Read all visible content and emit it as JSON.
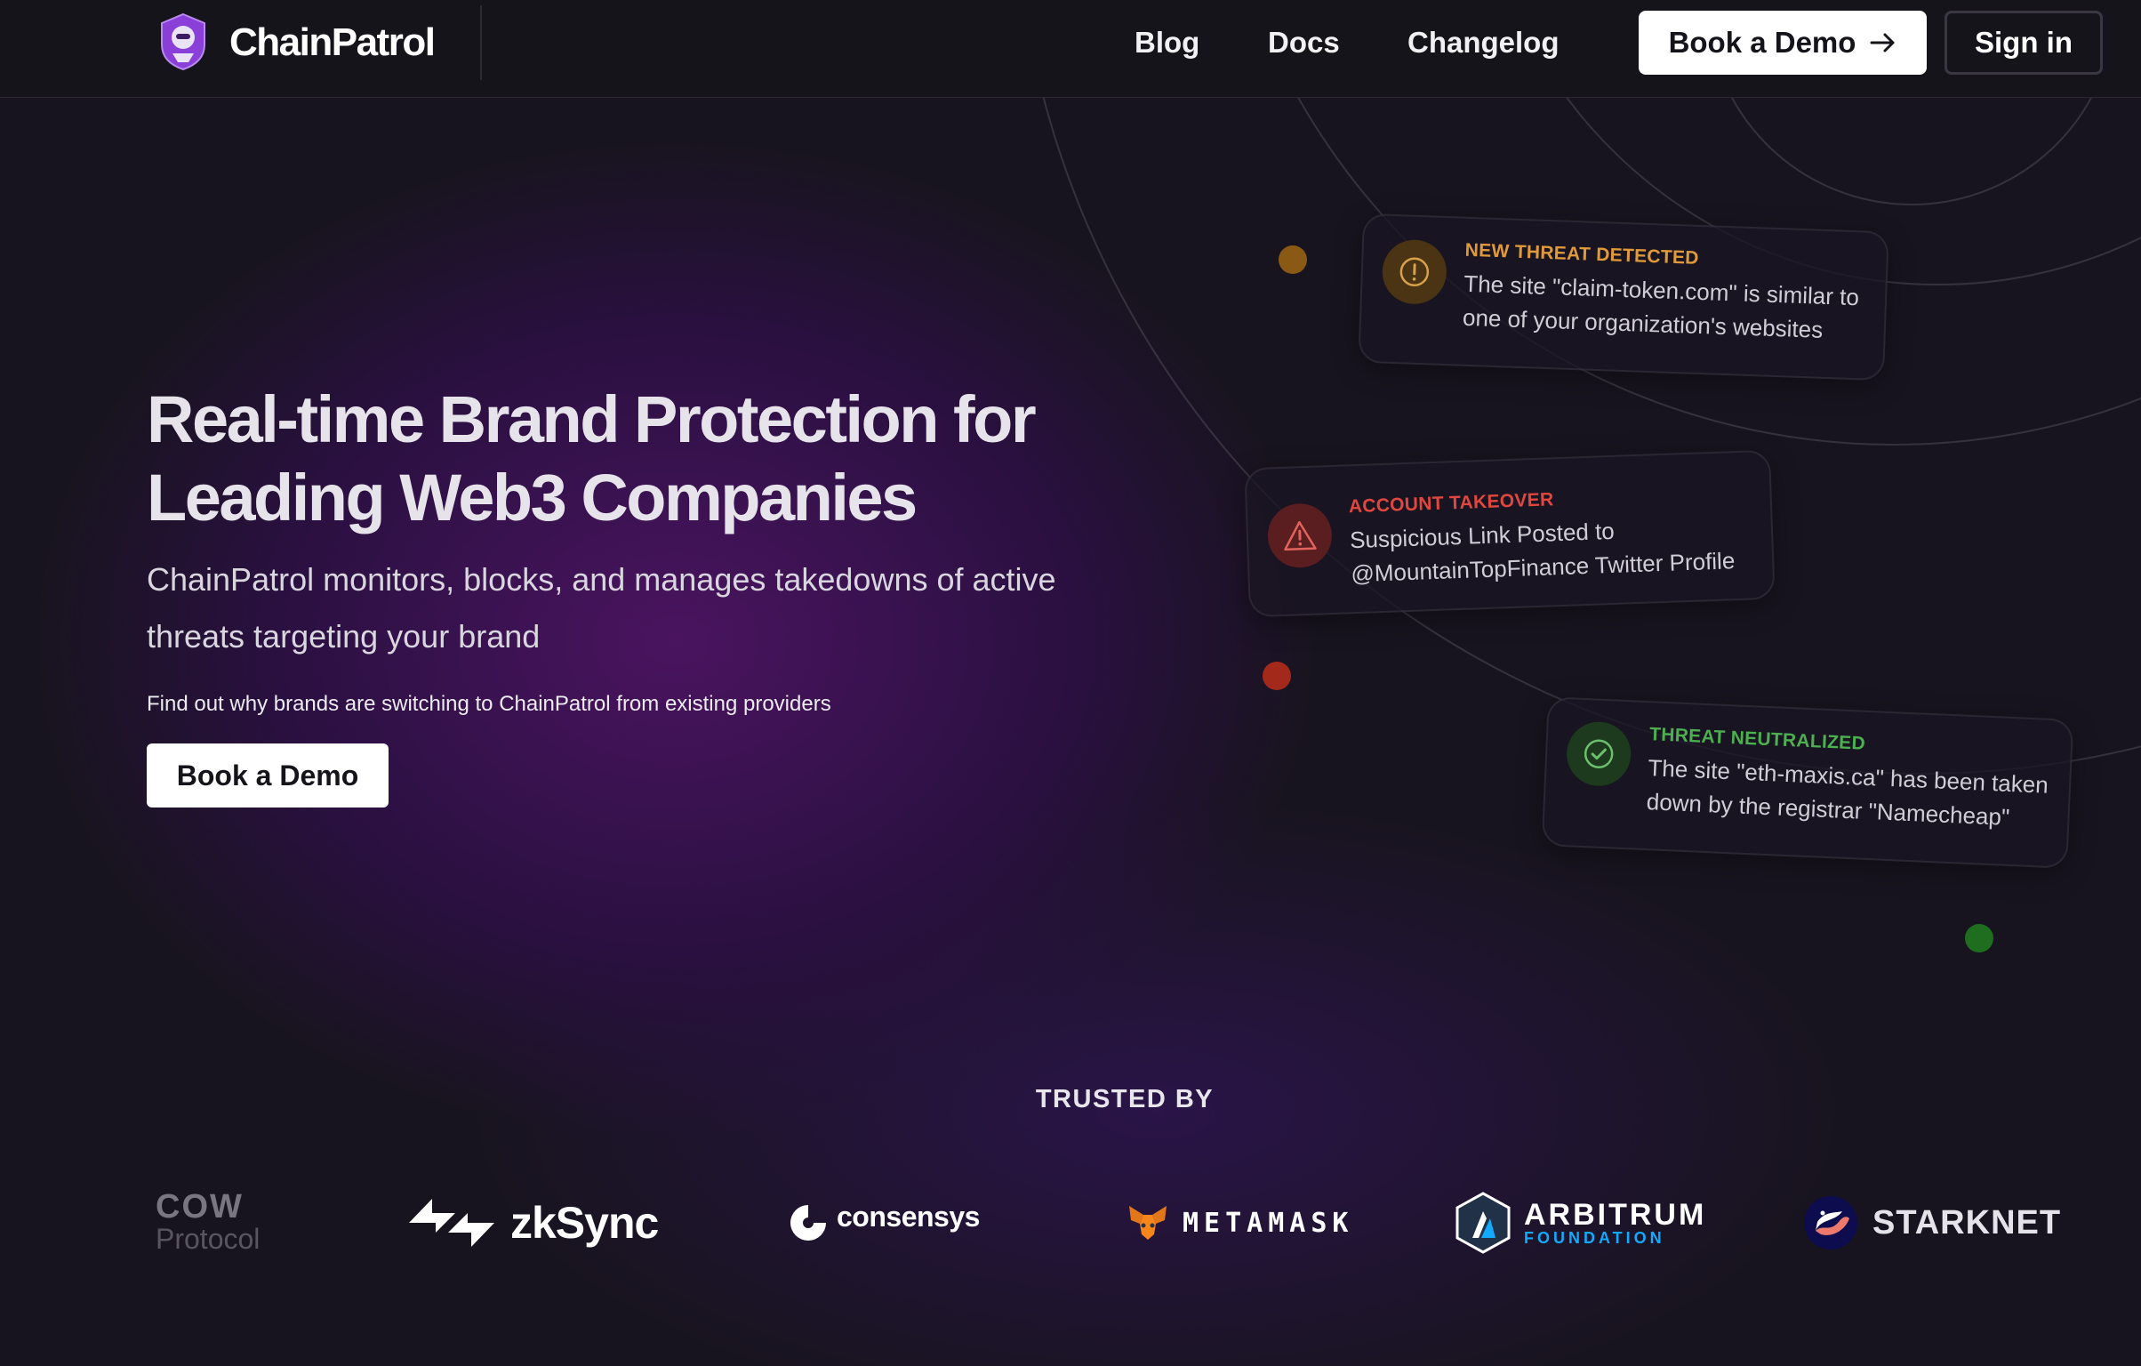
{
  "nav": {
    "brand": "ChainPatrol",
    "links": [
      "Blog",
      "Docs",
      "Changelog"
    ],
    "book_demo": "Book a Demo",
    "sign_in": "Sign in"
  },
  "hero": {
    "title_line1": "Real-time Brand Protection for",
    "title_line2": "Leading Web3 Companies",
    "subtitle": "ChainPatrol monitors, blocks, and manages takedowns of active threats targeting your brand",
    "note": "Find out why brands are switching to ChainPatrol from existing providers",
    "cta": "Book a Demo"
  },
  "cards": [
    {
      "tag": "NEW THREAT DETECTED",
      "message": "The site \"claim-token.com\" is similar to one of your organization's websites",
      "color": "#e09a3a"
    },
    {
      "tag": "ACCOUNT TAKEOVER",
      "message": "Suspicious Link Posted to @MountainTopFinance Twitter Profile",
      "color": "#e0473f"
    },
    {
      "tag": "THREAT NEUTRALIZED",
      "message": "The site \"eth-maxis.ca\" has been taken down by the registrar \"Namecheap\"",
      "color": "#4caf50"
    }
  ],
  "trusted": {
    "heading": "TRUSTED BY",
    "logos": {
      "cow_line1": "COW",
      "cow_line2": "Protocol",
      "zksync": "zkSync",
      "consensys": "consensys",
      "metamask": "METAMASK",
      "arbitrum_line1": "ARBITRUM",
      "arbitrum_line2": "FOUNDATION",
      "starknet": "STARKNET"
    }
  },
  "colors": {
    "background": "#18141f",
    "nav_bg": "#16141b",
    "accent_purple": "#7b2fbf"
  }
}
